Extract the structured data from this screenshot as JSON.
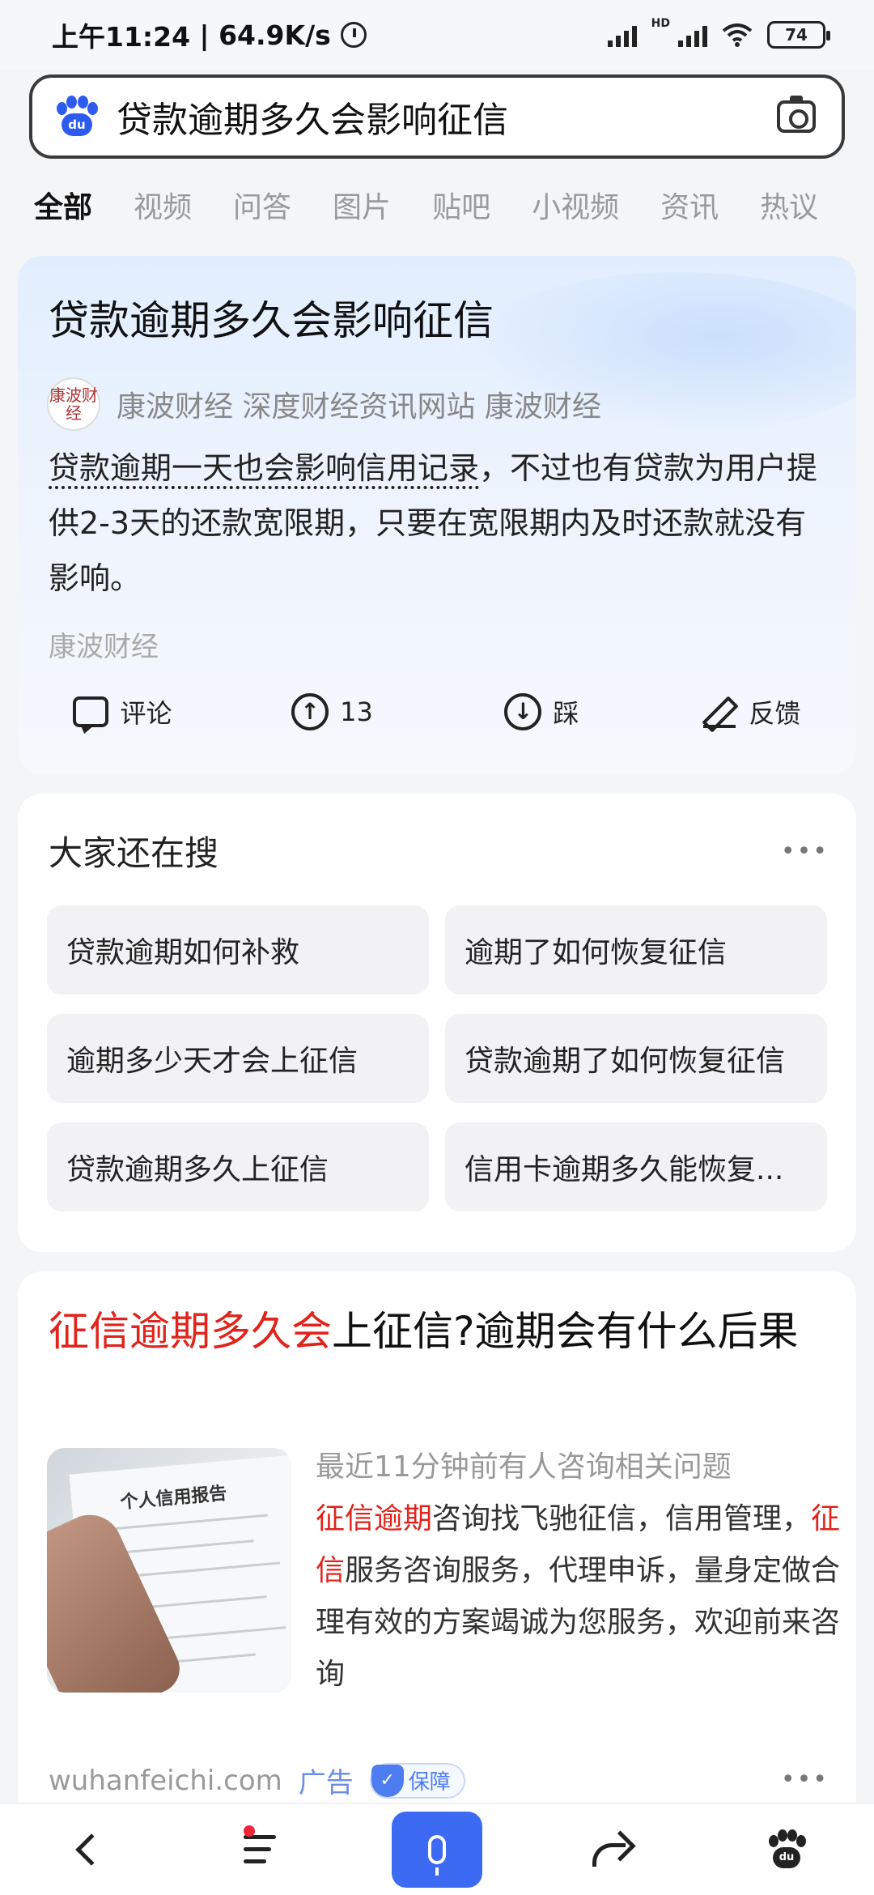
{
  "status_bar": {
    "time": "上午11:24",
    "speed": "64.9K/s",
    "hd_label": "HD",
    "battery": "74"
  },
  "search": {
    "query": "贷款逾期多久会影响征信",
    "logo_text": "du"
  },
  "tabs": [
    "全部",
    "视频",
    "问答",
    "图片",
    "贴吧",
    "小视频",
    "资讯",
    "热议"
  ],
  "answer_card": {
    "title": "贷款逾期多久会影响征信",
    "source_logo": "康波财经",
    "source_line": "康波财经 深度财经资讯网站 康波财经",
    "body_highlight": "贷款逾期一天也会影响信用记录",
    "body_rest": "，不过也有贷款为用户提供2-3天的还款宽限期，只要在宽限期内及时还款就没有影响。",
    "source_footer": "康波财经",
    "actions": {
      "comment": "评论",
      "upvote_count": "13",
      "downvote": "踩",
      "feedback": "反馈"
    }
  },
  "related": {
    "title": "大家还在搜",
    "more": "•••",
    "items": [
      "贷款逾期如何补救",
      "逾期了如何恢复征信",
      "逾期多少天才会上征信",
      "贷款逾期了如何恢复征信",
      "贷款逾期多久上征信",
      "信用卡逾期多久能恢复..."
    ]
  },
  "ad_card": {
    "title_red": "征信逾期多久会",
    "title_rest": "上征信?逾期会有什么后果",
    "image_doc_title": "个人信用报告",
    "notice": "最近11分钟前有人咨询相关问题",
    "text_red1": "征信逾期",
    "text_part1": "咨询找飞驰征信，信用管理，",
    "text_red2": "征信",
    "text_part2": "服务咨询服务，代理申诉，量身定做合理有效的方案竭诚为您服务，欢迎前来咨询",
    "domain": "wuhanfeichi.com",
    "ad_label": "广告",
    "guarantee": "保障",
    "more": "•••"
  },
  "bottom_nav": {
    "paw_text": "du"
  },
  "colors": {
    "accent_blue": "#3d6af2",
    "highlight_red": "#e0241b",
    "notification_dot": "#f0233a"
  }
}
